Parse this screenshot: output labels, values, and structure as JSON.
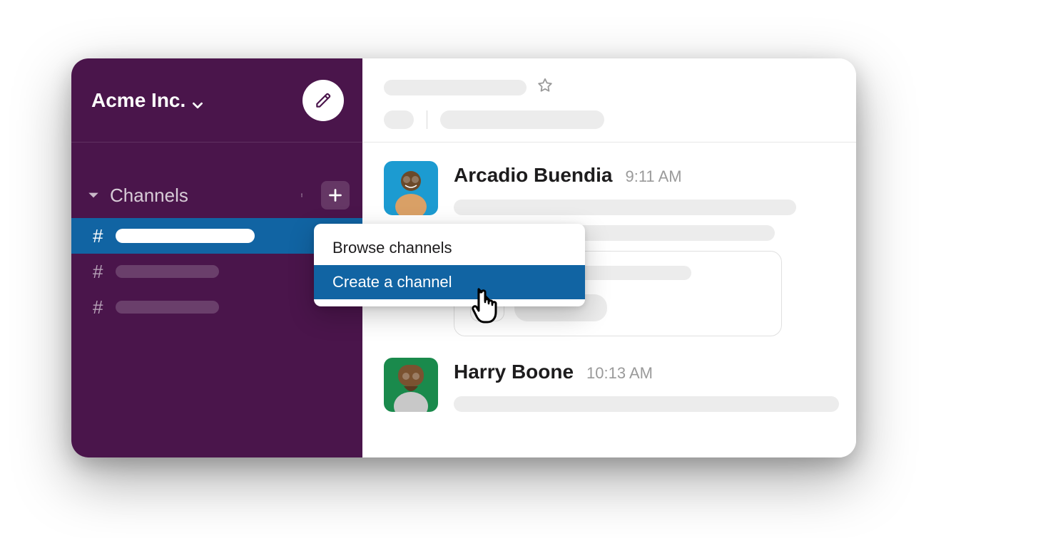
{
  "workspace": {
    "name": "Acme Inc."
  },
  "sidebar": {
    "section_title": "Channels"
  },
  "context_menu": {
    "items": [
      {
        "label": "Browse channels"
      },
      {
        "label": "Create a channel"
      }
    ]
  },
  "messages": [
    {
      "name": "Arcadio Buendia",
      "time": "9:11 AM",
      "avatar_bg": "#1c9bd1"
    },
    {
      "name": "Harry Boone",
      "time": "10:13 AM",
      "avatar_bg": "#1a8a4c"
    }
  ]
}
